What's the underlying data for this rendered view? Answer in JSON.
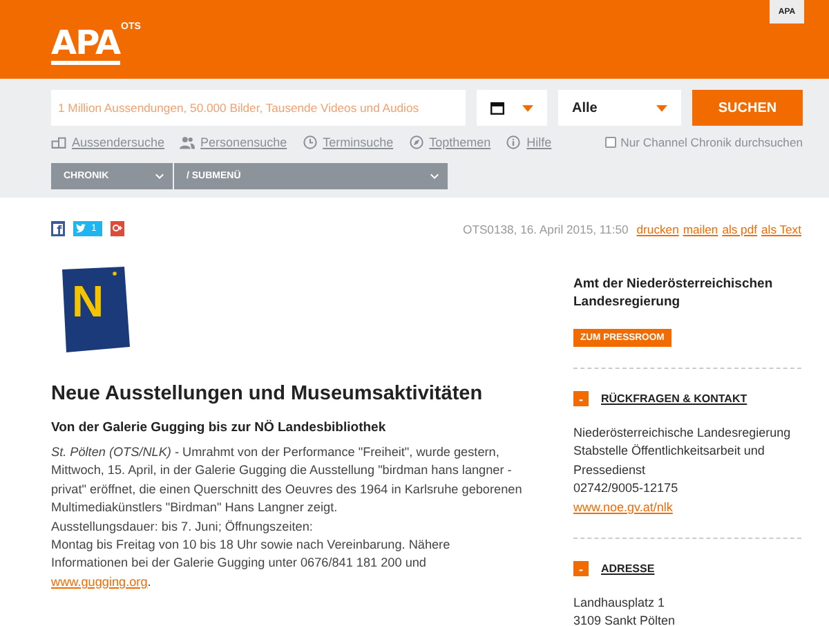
{
  "header": {
    "logo_text": "APA",
    "logo_suffix": "OTS",
    "corner_badge": "APA"
  },
  "search": {
    "placeholder": "1 Million Aussendungen, 50.000 Bilder, Tausende Videos und Audios",
    "category": "Alle",
    "button": "SUCHEN"
  },
  "search_links": [
    {
      "label": "Aussendersuche",
      "kind": "building"
    },
    {
      "label": "Personensuche",
      "kind": "people"
    },
    {
      "label": "Terminsuche",
      "kind": "clock"
    },
    {
      "label": "Topthemen",
      "kind": "compass"
    },
    {
      "label": "Hilfe",
      "kind": "info"
    }
  ],
  "channel_filter": {
    "label": "Nur Channel Chronik durchsuchen",
    "checked": false
  },
  "nav": [
    {
      "label": "CHRONIK"
    },
    {
      "label": "/ SUBMENÜ"
    }
  ],
  "share": {
    "twitter_count": "1"
  },
  "meta": {
    "text": "OTS0138, 16. April 2015, 11:50",
    "actions": [
      "drucken",
      "mailen",
      "als pdf",
      "als Text"
    ]
  },
  "article": {
    "logo_letter": "N",
    "title": "Neue Ausstellungen und Museumsaktivitäten",
    "subtitle": "Von der Galerie Gugging bis zur NÖ Landesbibliothek",
    "body_lines": [
      "*St. Pölten (OTS/NLK)* - Umrahmt von der Performance \"Freiheit\", wurde gestern, Mittwoch, 15. April, in der Galerie Gugging die Ausstellung \"birdman hans langner - privat\" eröffnet, die einen Querschnitt des Oeuvres des 1964 in Karlsruhe geborenen Multimediakünstlers \"Birdman\" Hans Langner zeigt.",
      "Ausstellungsdauer: bis 7. Juni; Öffnungszeiten:",
      "Montag bis Freitag von 10 bis 18 Uhr sowie nach Vereinbarung. Nähere Informationen bei der Galerie Gugging unter 0676/841 181 200 und"
    ],
    "link": "www.gugging.org",
    "link_suffix": "."
  },
  "sidebar": {
    "organization": "Amt der Niederösterreichischen Landesregierung",
    "pressroom_button": "ZUM PRESSROOM",
    "sections": [
      {
        "toggle": "-",
        "title": "RÜCKFRAGEN & KONTAKT",
        "lines": [
          "Niederösterreichische Landesregierung",
          "Stabstelle Öffentlichkeitsarbeit und Pressedienst",
          "02742/9005-12175"
        ],
        "link": "www.noe.gv.at/nlk"
      },
      {
        "toggle": "-",
        "title": "ADRESSE",
        "lines": [
          "Landhausplatz 1",
          "3109 Sankt Pölten"
        ]
      }
    ]
  }
}
